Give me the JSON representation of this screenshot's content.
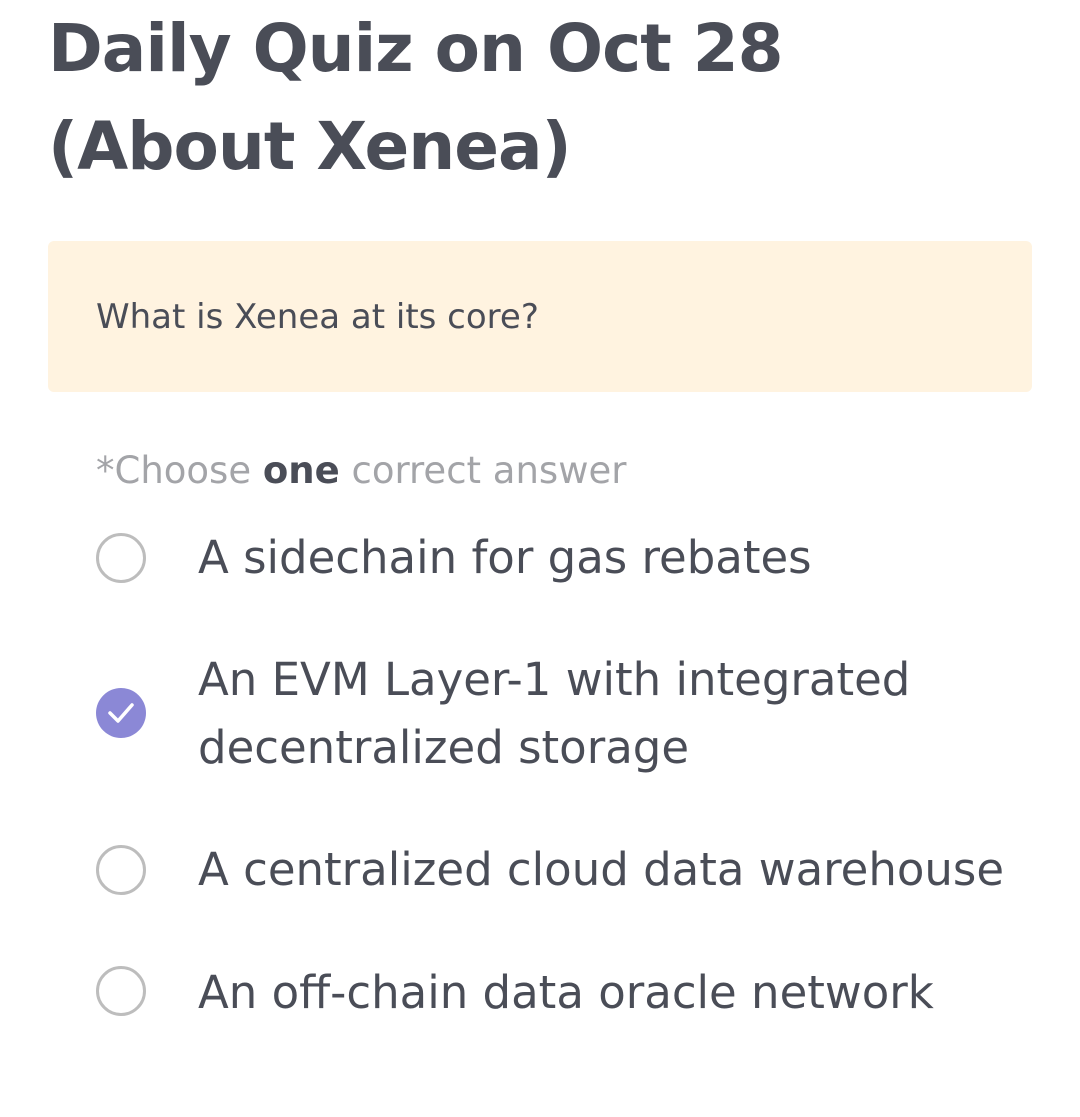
{
  "quiz": {
    "title": "Daily Quiz on Oct 28 (About Xenea)",
    "question": "What is Xenea at its core?",
    "instruction": {
      "prefix": "*Choose ",
      "emphasis": "one",
      "suffix": " correct answer"
    },
    "options": [
      {
        "label": "A sidechain for gas rebates",
        "selected": false
      },
      {
        "label": "An EVM Layer-1 with integrated decentralized storage",
        "selected": true
      },
      {
        "label": "A centralized cloud data warehouse",
        "selected": false
      },
      {
        "label": "An off-chain data oracle network",
        "selected": false
      }
    ]
  },
  "colors": {
    "text": "#4a4d57",
    "muted": "#a3a4a8",
    "question_background": "#fff3e0",
    "selected_radio": "#8b88d6",
    "radio_border": "#bdbdbd"
  },
  "icons": {
    "selected_mark": "checkmark-icon"
  }
}
